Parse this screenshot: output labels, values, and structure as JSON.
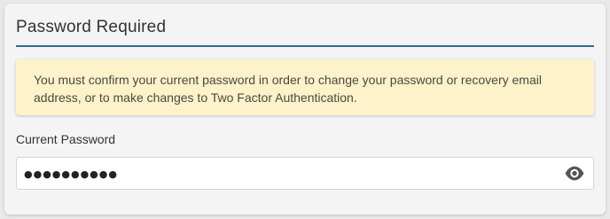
{
  "panel": {
    "title": "Password Required"
  },
  "alert": {
    "message": "You must confirm your current password in order to change your password or recovery email address, or to make changes to Two Factor Authentication."
  },
  "current_password": {
    "label": "Current Password",
    "value": "●●●●●●●●●●",
    "toggle_icon": "eye-icon"
  },
  "colors": {
    "title_rule": "#2e6c9c",
    "alert_background": "#fdf2c9",
    "eye_icon": "#555555"
  }
}
